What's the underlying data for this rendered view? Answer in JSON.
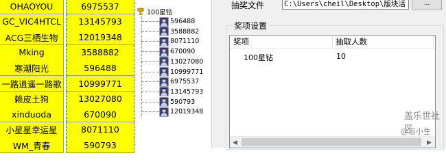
{
  "sheet": {
    "rows": [
      {
        "name": "OHAOYOU",
        "number": "6975537"
      },
      {
        "name": "GC_VIC4HTCL",
        "number": "13145793"
      },
      {
        "name": "ACG三栖生物",
        "number": "12019348"
      },
      {
        "name": "Mking",
        "number": "3588882"
      },
      {
        "name": "寒潮阳光",
        "number": "596488"
      },
      {
        "name": "一路逍遥一路歌",
        "number": "10999771"
      },
      {
        "name": "赖皮土狗",
        "number": "13027080"
      },
      {
        "name": "xinduoda",
        "number": "670090"
      },
      {
        "name": "小星星幸运星",
        "number": "8071110"
      },
      {
        "name": "WM_青春",
        "number": "590793"
      }
    ],
    "fill_color": "#ffff00"
  },
  "tree": {
    "root_label": "100星钻",
    "root_icon": "trophy-icon",
    "leaves": [
      "596488",
      "3588882",
      "8071110",
      "670090",
      "13027080",
      "10999771",
      "6975537",
      "13145793",
      "590793",
      "12019348"
    ],
    "leaf_icon": "person-icon"
  },
  "dialog": {
    "file_label": "抽奖文件",
    "file_path": "C:\\Users\\cheil\\Desktop\\版块活",
    "browse_label": "...",
    "group_title": "奖项设置",
    "columns": [
      "奖项",
      "抽取人数"
    ],
    "prizes": [
      {
        "name": "100星钻",
        "count": "10"
      }
    ],
    "scroll_left": "◀",
    "scroll_right": "▶"
  },
  "watermark": {
    "text": "盖乐世社区",
    "sub": "@百小生"
  }
}
